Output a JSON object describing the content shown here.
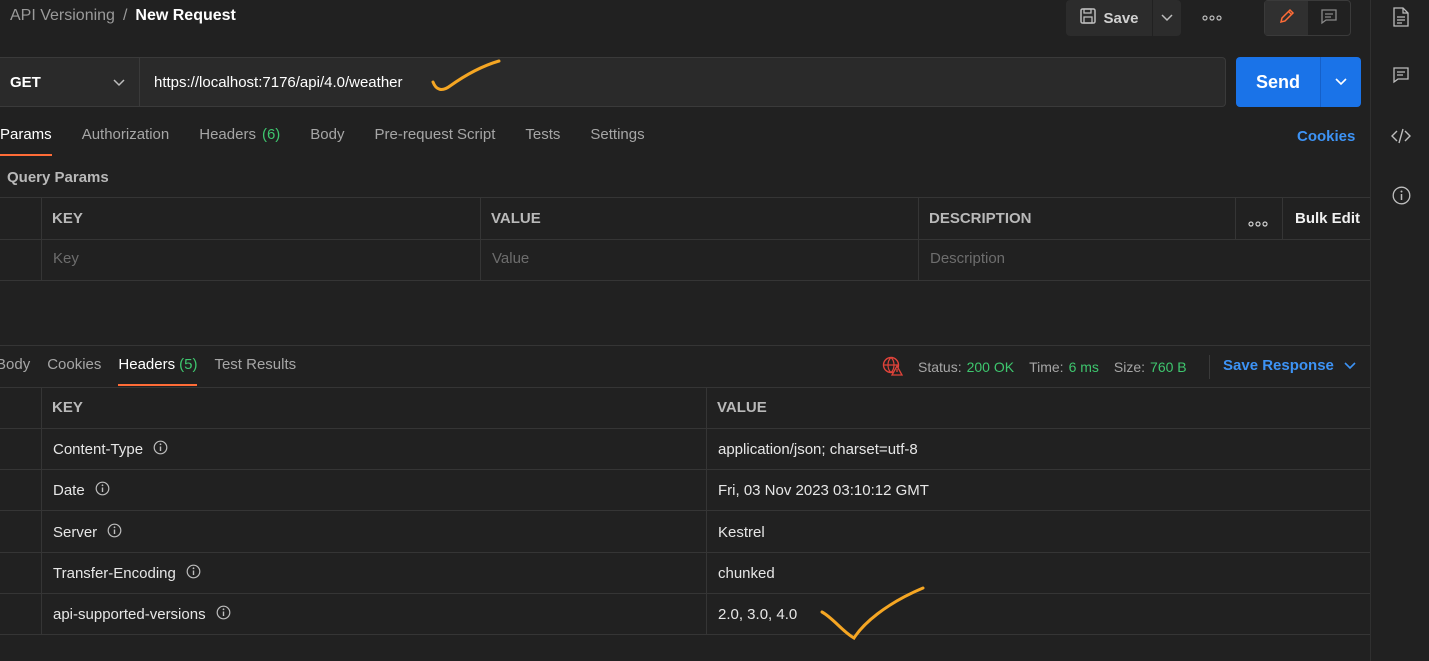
{
  "breadcrumb": {
    "collection": "API Versioning",
    "separator": "/",
    "title": "New Request"
  },
  "toolbar": {
    "save_label": "Save"
  },
  "request": {
    "method": "GET",
    "url": "https://localhost:7176/api/4.0/weather",
    "send_label": "Send"
  },
  "request_tabs": [
    {
      "label": "Params",
      "active": true
    },
    {
      "label": "Authorization"
    },
    {
      "label": "Headers",
      "count": "(6)"
    },
    {
      "label": "Body"
    },
    {
      "label": "Pre-request Script"
    },
    {
      "label": "Tests"
    },
    {
      "label": "Settings"
    }
  ],
  "cookies_link": "Cookies",
  "query_params": {
    "title": "Query Params",
    "columns": [
      "KEY",
      "VALUE",
      "DESCRIPTION"
    ],
    "bulk_edit": "Bulk Edit",
    "placeholders": {
      "key": "Key",
      "value": "Value",
      "description": "Description"
    }
  },
  "response_tabs": [
    {
      "label": "Body"
    },
    {
      "label": "Cookies"
    },
    {
      "label": "Headers",
      "count": "(5)",
      "active": true
    },
    {
      "label": "Test Results"
    }
  ],
  "response_status": {
    "status_label": "Status:",
    "status_value": "200 OK",
    "time_label": "Time:",
    "time_value": "6 ms",
    "size_label": "Size:",
    "size_value": "760 B",
    "save_response": "Save Response"
  },
  "response_headers": {
    "columns": [
      "KEY",
      "VALUE"
    ],
    "rows": [
      {
        "key": "Content-Type",
        "value": "application/json; charset=utf-8"
      },
      {
        "key": "Date",
        "value": "Fri, 03 Nov 2023 03:10:12 GMT"
      },
      {
        "key": "Server",
        "value": "Kestrel"
      },
      {
        "key": "Transfer-Encoding",
        "value": "chunked"
      },
      {
        "key": "api-supported-versions",
        "value": "2.0, 3.0, 4.0"
      }
    ]
  },
  "colors": {
    "accent_orange": "#ff6c37",
    "send_blue": "#1a73e8",
    "link_blue": "#3d93f5",
    "success_green": "#3ec66e",
    "annotation": "#f5a623"
  },
  "icons": [
    "save-icon",
    "chevron-down-icon",
    "more-icon",
    "edit-icon",
    "comment-icon",
    "document-icon",
    "code-icon",
    "info-icon",
    "globe-warning-icon"
  ]
}
